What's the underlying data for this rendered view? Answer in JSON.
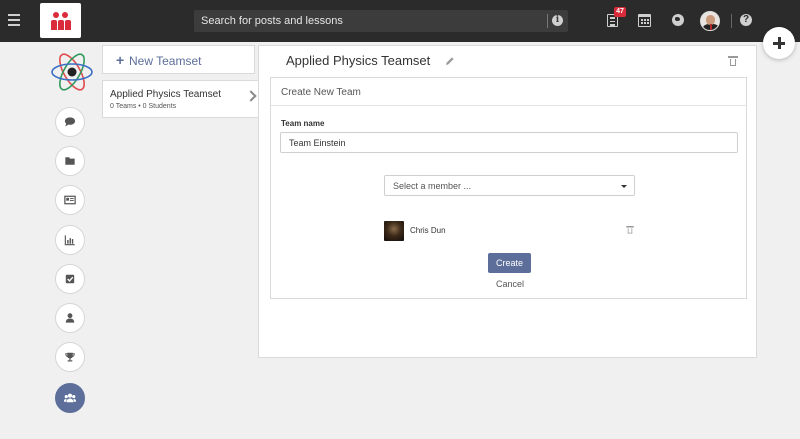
{
  "topbar": {
    "search_placeholder": "Search for posts and lessons",
    "notification_count": "47",
    "brand_color": "#d92b3a",
    "icons": [
      "menu-icon",
      "logo",
      "info-icon",
      "document-icon",
      "calendar-icon",
      "globe-icon",
      "avatar",
      "help-icon"
    ]
  },
  "fab": {
    "icon": "plus-icon"
  },
  "sidebar": {
    "items": [
      {
        "icon": "comment-icon",
        "active": false
      },
      {
        "icon": "folder-icon",
        "active": false
      },
      {
        "icon": "id-card-icon",
        "active": false
      },
      {
        "icon": "bar-chart-icon",
        "active": false
      },
      {
        "icon": "checkbox-icon",
        "active": false
      },
      {
        "icon": "user-icon",
        "active": false
      },
      {
        "icon": "trophy-icon",
        "active": false
      },
      {
        "icon": "users-icon",
        "active": true
      }
    ]
  },
  "teamsets": {
    "new_label": "New Teamset",
    "items": [
      {
        "name": "Applied Physics Teamset",
        "meta": "0 Teams • 0 Students"
      }
    ]
  },
  "main": {
    "title": "Applied Physics Teamset",
    "card": {
      "title": "Create New Team",
      "team_name_label": "Team name",
      "team_name_value": "Team Einstein",
      "member_select_placeholder": "Select a member ...",
      "members": [
        {
          "name": "Chris Dun"
        }
      ],
      "create_label": "Create",
      "cancel_label": "Cancel"
    }
  },
  "colors": {
    "accent": "#5c6e99",
    "topbar": "#2b2b2b",
    "background": "#f0f0f1"
  }
}
